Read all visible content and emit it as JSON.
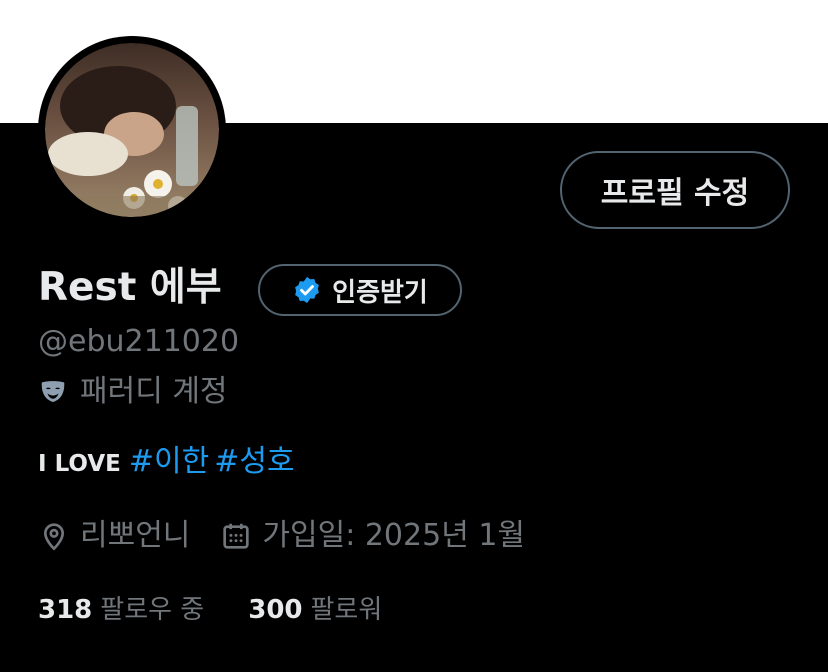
{
  "profile": {
    "display_name": "Rest 에부",
    "handle": "@ebu211020",
    "category_label": "패러디 계정",
    "bio": {
      "text": "I LOVE ",
      "hashtags": [
        "#이한",
        "#성호"
      ]
    },
    "location": "리뽀언니",
    "joined": "가입일: 2025년 1월",
    "following_count": "318",
    "following_label": "팔로우 중",
    "followers_count": "300",
    "followers_label": "팔로워"
  },
  "buttons": {
    "edit_profile": "프로필 수정",
    "get_verified": "인증받기"
  },
  "colors": {
    "background": "#000000",
    "banner": "#ffffff",
    "text_primary": "#e7e9ea",
    "text_secondary": "#71767b",
    "link": "#1d9bf0",
    "border": "#536471"
  },
  "icons": {
    "verified": "verified-badge-icon",
    "category": "parody-mask-icon",
    "location": "location-pin-icon",
    "joined": "calendar-icon"
  }
}
